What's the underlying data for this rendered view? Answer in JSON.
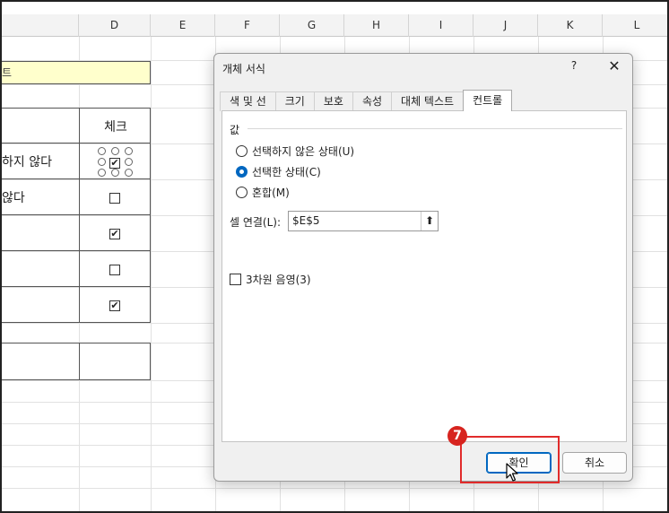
{
  "spreadsheet": {
    "columns": [
      "D",
      "E",
      "F",
      "G",
      "H",
      "I",
      "J",
      "K",
      "L"
    ],
    "yellow_cell_text": "트",
    "header_cell": "체크",
    "rows": [
      {
        "text": "하지 않다",
        "checked": true
      },
      {
        "text": "않다",
        "checked": false
      },
      {
        "text": "",
        "checked": true
      },
      {
        "text": "",
        "checked": false
      },
      {
        "text": "",
        "checked": true
      }
    ],
    "check_mark": "✔"
  },
  "dialog": {
    "title": "개체 서식",
    "help_label": "?",
    "close_label": "✕",
    "tabs": [
      {
        "label": "색 및 선"
      },
      {
        "label": "크기"
      },
      {
        "label": "보호"
      },
      {
        "label": "속성"
      },
      {
        "label": "대체 텍스트"
      },
      {
        "label": "컨트롤"
      }
    ],
    "active_tab": "컨트롤",
    "value_group_label": "값",
    "radios": [
      {
        "label": "선택하지 않은 상태(U)",
        "selected": false
      },
      {
        "label": "선택한 상태(C)",
        "selected": true
      },
      {
        "label": "혼합(M)",
        "selected": false
      }
    ],
    "cell_link_label": "셀 연결(L):",
    "cell_link_value": "$E$5",
    "ref_button_label": "⬆",
    "shading_3d_label": "3차원 음영(3)",
    "ok_label": "확인",
    "cancel_label": "취소"
  },
  "annotation": {
    "step_number": "7",
    "highlight_color": "#e12b2b"
  }
}
